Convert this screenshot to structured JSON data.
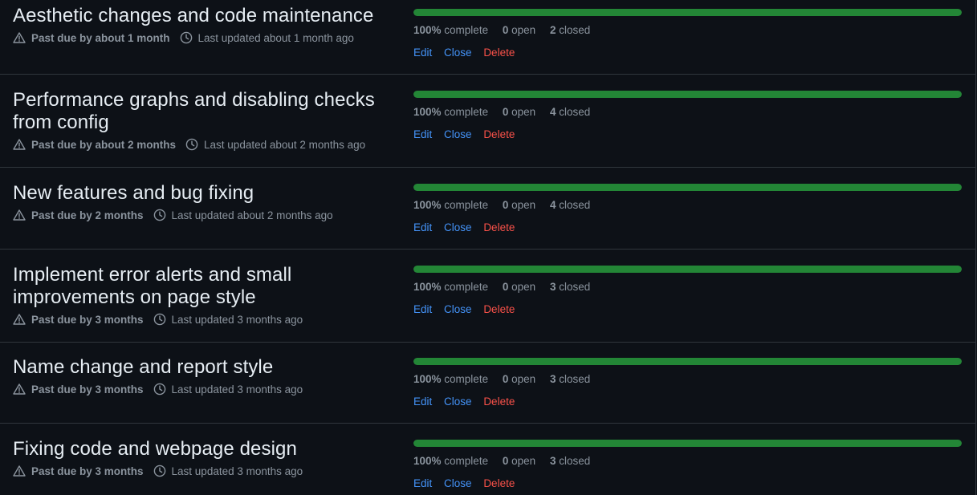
{
  "milestones": [
    {
      "title": "Aesthetic changes and code maintenance",
      "due": "Past due by about 1 month",
      "updated": "Last updated about 1 month ago",
      "percent": "100%",
      "percent_label": "complete",
      "progress": 1.0,
      "open": "0",
      "open_label": "open",
      "closed": "2",
      "closed_label": "closed",
      "edit": "Edit",
      "close": "Close",
      "delete": "Delete"
    },
    {
      "title": "Performance graphs and disabling checks from config",
      "due": "Past due by about 2 months",
      "updated": "Last updated about 2 months ago",
      "percent": "100%",
      "percent_label": "complete",
      "progress": 1.0,
      "open": "0",
      "open_label": "open",
      "closed": "4",
      "closed_label": "closed",
      "edit": "Edit",
      "close": "Close",
      "delete": "Delete"
    },
    {
      "title": "New features and bug fixing",
      "due": "Past due by 2 months",
      "updated": "Last updated about 2 months ago",
      "percent": "100%",
      "percent_label": "complete",
      "progress": 1.0,
      "open": "0",
      "open_label": "open",
      "closed": "4",
      "closed_label": "closed",
      "edit": "Edit",
      "close": "Close",
      "delete": "Delete"
    },
    {
      "title": "Implement error alerts and small improvements on page style",
      "due": "Past due by 3 months",
      "updated": "Last updated 3 months ago",
      "percent": "100%",
      "percent_label": "complete",
      "progress": 1.0,
      "open": "0",
      "open_label": "open",
      "closed": "3",
      "closed_label": "closed",
      "edit": "Edit",
      "close": "Close",
      "delete": "Delete"
    },
    {
      "title": "Name change and report style",
      "due": "Past due by 3 months",
      "updated": "Last updated 3 months ago",
      "percent": "100%",
      "percent_label": "complete",
      "progress": 1.0,
      "open": "0",
      "open_label": "open",
      "closed": "3",
      "closed_label": "closed",
      "edit": "Edit",
      "close": "Close",
      "delete": "Delete"
    },
    {
      "title": "Fixing code and webpage design",
      "due": "Past due by 3 months",
      "updated": "Last updated 3 months ago",
      "percent": "100%",
      "percent_label": "complete",
      "progress": 1.0,
      "open": "0",
      "open_label": "open",
      "closed": "3",
      "closed_label": "closed",
      "edit": "Edit",
      "close": "Close",
      "delete": "Delete"
    }
  ],
  "icons": {
    "due": "alert-triangle-icon",
    "updated": "clock-icon"
  },
  "colors": {
    "background": "#0d1117",
    "progress_fill": "#238636",
    "link": "#4493f8",
    "danger": "#f85149",
    "muted": "#8b949e",
    "border": "#30363d"
  }
}
